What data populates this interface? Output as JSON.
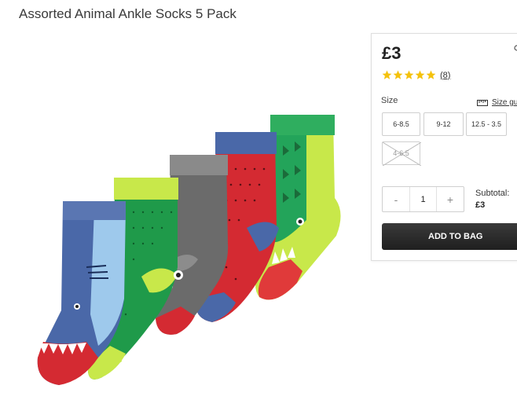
{
  "product": {
    "title": "Assorted Animal Ankle Socks 5 Pack",
    "image_alt": "Assorted Animal Ankle Socks 5 Pack"
  },
  "purchase_panel": {
    "price": "£3",
    "rating": {
      "stars": 5,
      "review_count": "(8)"
    },
    "size_label": "Size",
    "size_guide_label": "Size gu",
    "size_guide_icon": "ruler-icon",
    "sizes": [
      {
        "label": "6-8.5",
        "available": true
      },
      {
        "label": "9-12",
        "available": true
      },
      {
        "label": "12.5 - 3.5",
        "available": true
      },
      {
        "label": "4-6.5",
        "available": false
      }
    ],
    "quantity": {
      "minus": "-",
      "value": "1",
      "plus": "+"
    },
    "subtotal_label": "Subtotal:",
    "subtotal_value": "£3",
    "add_to_bag_label": "ADD TO BAG"
  },
  "colors": {
    "star": "#f4c20d",
    "button_dark": "#2b2b2b",
    "border": "#cfcfcf"
  }
}
